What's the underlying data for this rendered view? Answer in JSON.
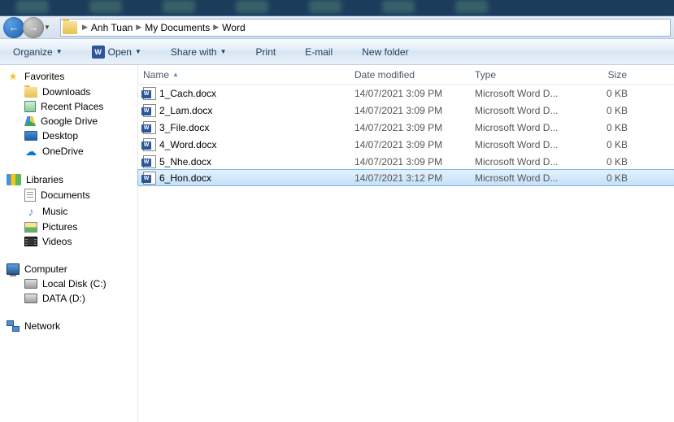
{
  "breadcrumb": {
    "seg1": "Anh Tuan",
    "seg2": "My Documents",
    "seg3": "Word"
  },
  "toolbar": {
    "organize": "Organize",
    "open": "Open",
    "sharewith": "Share with",
    "print": "Print",
    "email": "E-mail",
    "newfolder": "New folder"
  },
  "sidebar": {
    "favorites": "Favorites",
    "downloads": "Downloads",
    "recent": "Recent Places",
    "gdrive": "Google Drive",
    "desktop": "Desktop",
    "onedrive": "OneDrive",
    "libraries": "Libraries",
    "documents": "Documents",
    "music": "Music",
    "pictures": "Pictures",
    "videos": "Videos",
    "computer": "Computer",
    "localdisk": "Local Disk (C:)",
    "data": "DATA (D:)",
    "network": "Network"
  },
  "columns": {
    "name": "Name",
    "date": "Date modified",
    "type": "Type",
    "size": "Size"
  },
  "files": [
    {
      "name": "1_Cach.docx",
      "date": "14/07/2021 3:09 PM",
      "type": "Microsoft Word D...",
      "size": "0 KB",
      "selected": false
    },
    {
      "name": "2_Lam.docx",
      "date": "14/07/2021 3:09 PM",
      "type": "Microsoft Word D...",
      "size": "0 KB",
      "selected": false
    },
    {
      "name": "3_File.docx",
      "date": "14/07/2021 3:09 PM",
      "type": "Microsoft Word D...",
      "size": "0 KB",
      "selected": false
    },
    {
      "name": "4_Word.docx",
      "date": "14/07/2021 3:09 PM",
      "type": "Microsoft Word D...",
      "size": "0 KB",
      "selected": false
    },
    {
      "name": "5_Nhe.docx",
      "date": "14/07/2021 3:09 PM",
      "type": "Microsoft Word D...",
      "size": "0 KB",
      "selected": false
    },
    {
      "name": "6_Hon.docx",
      "date": "14/07/2021 3:12 PM",
      "type": "Microsoft Word D...",
      "size": "0 KB",
      "selected": true
    }
  ]
}
